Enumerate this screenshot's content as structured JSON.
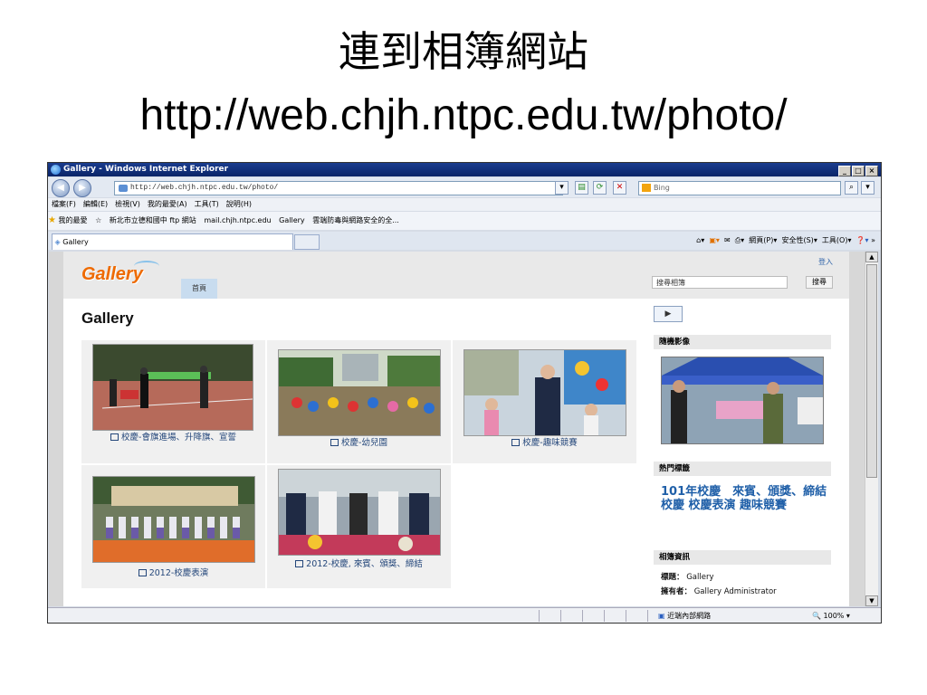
{
  "slide": {
    "title": "連到相簿網站",
    "url": "http://web.chjh.ntpc.edu.tw/photo/"
  },
  "browser": {
    "window_title": "Gallery - Windows Internet Explorer",
    "address": "http://web.chjh.ntpc.edu.tw/photo/",
    "search_provider": "Bing",
    "menu": [
      "檔案(F)",
      "編輯(E)",
      "檢視(V)",
      "我的最愛(A)",
      "工具(T)",
      "說明(H)"
    ],
    "favorites_label": "我的最愛",
    "favorites": [
      "新北市立德和國中 ftp 網站",
      "mail.chjh.ntpc.edu",
      "Gallery",
      "雲端防毒與網路安全的全..."
    ],
    "tab_title": "Gallery",
    "commands": {
      "page": "網頁(P)",
      "safety": "安全性(S)",
      "tools": "工具(O)"
    },
    "status": {
      "zone": "近端內部網路",
      "zoom": "100%"
    }
  },
  "site": {
    "logo": "Gallery",
    "nav_home": "首頁",
    "login": "登入",
    "search_placeholder": "搜尋相簿",
    "search_button": "搜尋",
    "heading": "Gallery",
    "albums": [
      {
        "title": "校慶-會旗進場、升降旗、宣誓"
      },
      {
        "title": "校慶-幼兒園"
      },
      {
        "title": "校慶-趣味競賽"
      },
      {
        "title": "2012-校慶表演"
      },
      {
        "title": "2012-校慶, 來賓、頒獎、締結"
      }
    ],
    "sidebar": {
      "random_photo_header": "隨機影像",
      "tags_header": "熱門標籤",
      "tags_text": "101年校慶　來賓、頒獎、締結 校慶 校慶表演 趣味競賽",
      "album_info_header": "相簿資訊",
      "title_label": "標題：",
      "title_value": "Gallery",
      "owner_label": "擁有者：",
      "owner_value": "Gallery Administrator"
    }
  },
  "colors": {
    "titlebar": "#0a2568",
    "logo_orange": "#ee6a00",
    "link_blue": "#1f5fa8",
    "page_bg": "#d7d7d7"
  }
}
